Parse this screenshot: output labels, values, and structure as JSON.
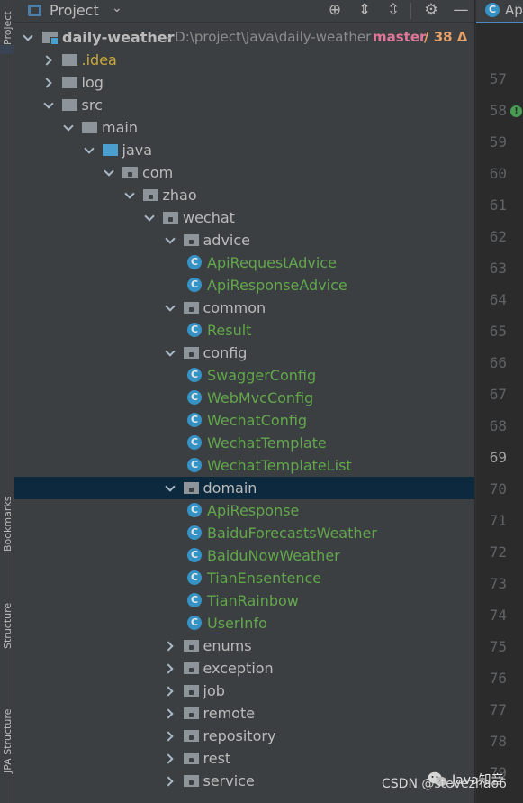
{
  "left_strip": {
    "tabs": [
      {
        "id": "project",
        "label": "Project"
      },
      {
        "id": "bookmarks",
        "label": "Bookmarks"
      },
      {
        "id": "structure",
        "label": "Structure"
      },
      {
        "id": "jpa-structure",
        "label": "JPA Structure"
      }
    ]
  },
  "toolbar": {
    "title": "Project",
    "icons": [
      "crosshair-icon",
      "expand-all-icon",
      "collapse-all-icon",
      "gear-icon",
      "minimize-icon"
    ]
  },
  "tree": {
    "root": {
      "name": "daily-weather",
      "path": "- D:\\project\\Java\\daily-weather",
      "branch": "master",
      "changes": "/ 38 Δ"
    },
    "nodes": [
      {
        "label": ".idea",
        "kind": "dir-idea",
        "state": "collapsed",
        "depth": 1
      },
      {
        "label": "log",
        "kind": "dir",
        "state": "collapsed",
        "depth": 1
      },
      {
        "label": "src",
        "kind": "dir",
        "state": "expanded",
        "depth": 1
      },
      {
        "label": "main",
        "kind": "dir",
        "state": "expanded",
        "depth": 2
      },
      {
        "label": "java",
        "kind": "dir-source",
        "state": "expanded",
        "depth": 3
      },
      {
        "label": "com",
        "kind": "package",
        "state": "expanded",
        "depth": 4
      },
      {
        "label": "zhao",
        "kind": "package",
        "state": "expanded",
        "depth": 5
      },
      {
        "label": "wechat",
        "kind": "package",
        "state": "expanded",
        "depth": 6
      },
      {
        "label": "advice",
        "kind": "package",
        "state": "expanded",
        "depth": 7
      },
      {
        "label": "ApiRequestAdvice",
        "kind": "class",
        "depth": 8
      },
      {
        "label": "ApiResponseAdvice",
        "kind": "class",
        "depth": 8
      },
      {
        "label": "common",
        "kind": "package",
        "state": "expanded",
        "depth": 7
      },
      {
        "label": "Result",
        "kind": "class",
        "depth": 8
      },
      {
        "label": "config",
        "kind": "package",
        "state": "expanded",
        "depth": 7
      },
      {
        "label": "SwaggerConfig",
        "kind": "class",
        "depth": 8
      },
      {
        "label": "WebMvcConfig",
        "kind": "class",
        "depth": 8
      },
      {
        "label": "WechatConfig",
        "kind": "class",
        "depth": 8
      },
      {
        "label": "WechatTemplate",
        "kind": "class",
        "depth": 8
      },
      {
        "label": "WechatTemplateList",
        "kind": "class",
        "depth": 8
      },
      {
        "label": "domain",
        "kind": "package",
        "state": "expanded",
        "depth": 7,
        "selected": true
      },
      {
        "label": "ApiResponse",
        "kind": "class",
        "depth": 8
      },
      {
        "label": "BaiduForecastsWeather",
        "kind": "class",
        "depth": 8
      },
      {
        "label": "BaiduNowWeather",
        "kind": "class",
        "depth": 8
      },
      {
        "label": "TianEnsentence",
        "kind": "class",
        "depth": 8
      },
      {
        "label": "TianRainbow",
        "kind": "class",
        "depth": 8
      },
      {
        "label": "UserInfo",
        "kind": "class",
        "depth": 8
      },
      {
        "label": "enums",
        "kind": "package",
        "state": "collapsed",
        "depth": 7
      },
      {
        "label": "exception",
        "kind": "package",
        "state": "collapsed",
        "depth": 7
      },
      {
        "label": "job",
        "kind": "package",
        "state": "collapsed",
        "depth": 7
      },
      {
        "label": "remote",
        "kind": "package",
        "state": "collapsed",
        "depth": 7
      },
      {
        "label": "repository",
        "kind": "package",
        "state": "collapsed",
        "depth": 7
      },
      {
        "label": "rest",
        "kind": "package",
        "state": "collapsed",
        "depth": 7
      },
      {
        "label": "service",
        "kind": "package",
        "state": "collapsed",
        "depth": 7
      }
    ]
  },
  "editor": {
    "tab_label": "Ap",
    "line_numbers": [
      "57",
      "58",
      "59",
      "60",
      "61",
      "62",
      "63",
      "64",
      "65",
      "66",
      "67",
      "68",
      "69",
      "70",
      "71",
      "72",
      "73",
      "74",
      "75",
      "76",
      "77",
      "78",
      "79"
    ],
    "current_line": "69",
    "marker_line": "58"
  },
  "watermark": {
    "text": "CSDN @stevezhao6",
    "brand": "Java知音"
  },
  "colors": {
    "panel_bg": "#3c3f41",
    "editor_bg": "#2b2b2b",
    "class_text": "#62a74c",
    "selection": "#0d293e",
    "branch": "#e0779a",
    "changes": "#e6a06a"
  }
}
